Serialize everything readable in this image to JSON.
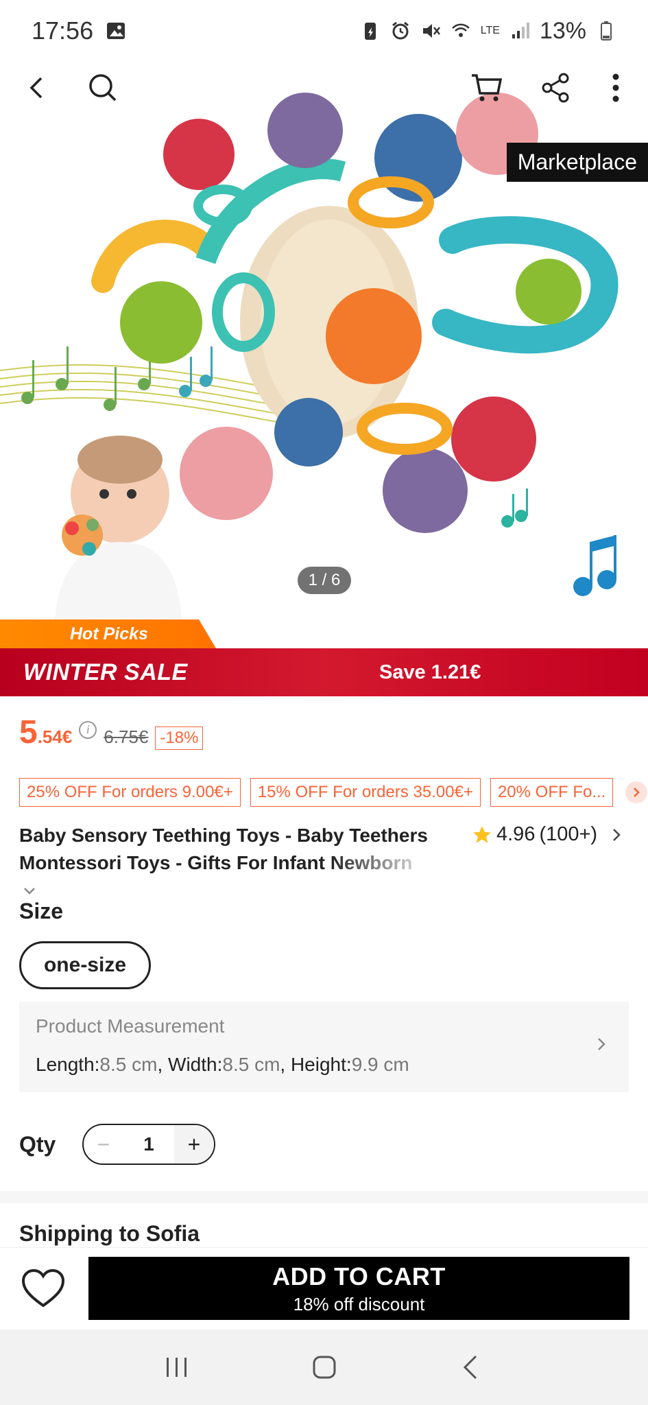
{
  "status_bar": {
    "time": "17:56",
    "battery": "13%",
    "network": "LTE"
  },
  "top_nav": {
    "back_icon": "chevron-left-icon",
    "search_icon": "search-icon",
    "cart_icon": "cart-icon",
    "share_icon": "share-icon",
    "more_icon": "more-vertical-icon"
  },
  "hero": {
    "marketplace_label": "Marketplace",
    "pager": "1 / 6"
  },
  "promo": {
    "hot_picks": "Hot Picks",
    "banner_title": "WINTER SALE",
    "banner_save": "Save 1.21€"
  },
  "price": {
    "main": "5",
    "cents": ".54€",
    "info": "i",
    "old": "6.75€",
    "discount": "-18%"
  },
  "coupons": [
    "25% OFF For orders 9.00€+",
    "15% OFF For orders 35.00€+",
    "20% OFF Fo..."
  ],
  "product": {
    "title_line1": "Baby Sensory Teething Toys - Baby Teethers",
    "title_line2_a": "Montessori Toys - Gifts For Infant ",
    "title_line2_b": "Newborn",
    "rating": "4.96",
    "reviews": "(100+)"
  },
  "size": {
    "label": "Size",
    "selected": "one-size"
  },
  "measurement": {
    "heading": "Product Measurement",
    "length_label": "Length:",
    "length_value": "8.5 cm",
    "width_label": ", Width:",
    "width_value": "8.5 cm",
    "height_label": ", Height:",
    "height_value": "9.9 cm"
  },
  "qty": {
    "label": "Qty",
    "value": "1",
    "minus": "−",
    "plus": "+"
  },
  "shipping": {
    "title": "Shipping to Sofia"
  },
  "bottom_bar": {
    "add_to_cart": "ADD TO CART",
    "discount_note": "18% off discount"
  },
  "colors": {
    "accent": "#fa6338",
    "banner": "#c8102e",
    "hot_picks": "#ff8000",
    "cta": "#000000"
  }
}
